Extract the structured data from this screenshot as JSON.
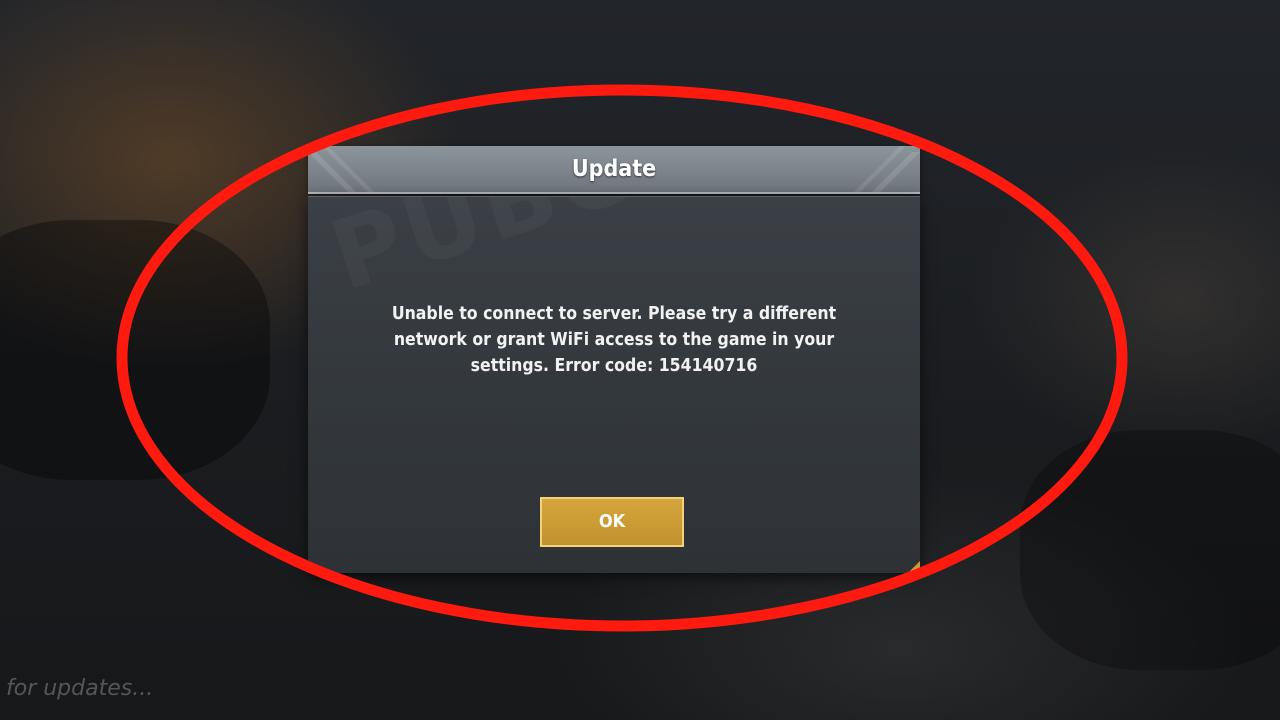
{
  "dialog": {
    "title": "Update",
    "message": "Unable to connect to server. Please try a different network or grant WiFi access to the game in your settings. Error code: 154140716",
    "ok_label": "OK"
  },
  "background": {
    "status_text": "for updates...",
    "logo_watermark": "PUBG MOBILE"
  },
  "colors": {
    "annotation_circle": "#ff1a10",
    "ok_button": "#c9992f",
    "ok_border": "#f3d37a",
    "header": "#7d858c",
    "body": "#363b40"
  }
}
